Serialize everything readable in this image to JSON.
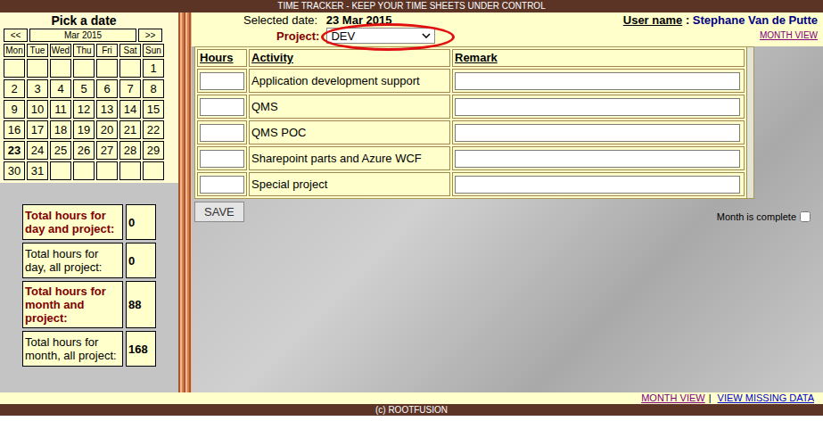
{
  "header": {
    "title": "TIME TRACKER - KEEP YOUR TIME SHEETS UNDER CONTROL"
  },
  "calendar": {
    "title": "Pick a date",
    "prev": "<<",
    "month": "Mar 2015",
    "next": ">>",
    "weekdays": [
      "Mon",
      "Tue",
      "Wed",
      "Thu",
      "Fri",
      "Sat",
      "Sun"
    ],
    "weeks": [
      [
        {
          "day": "",
          "selected": false
        },
        {
          "day": "",
          "selected": false
        },
        {
          "day": "",
          "selected": false
        },
        {
          "day": "",
          "selected": false
        },
        {
          "day": "",
          "selected": false
        },
        {
          "day": "",
          "selected": false
        },
        {
          "day": "1",
          "selected": false
        }
      ],
      [
        {
          "day": "2",
          "selected": false
        },
        {
          "day": "3",
          "selected": false
        },
        {
          "day": "4",
          "selected": false
        },
        {
          "day": "5",
          "selected": false
        },
        {
          "day": "6",
          "selected": false
        },
        {
          "day": "7",
          "selected": false
        },
        {
          "day": "8",
          "selected": false
        }
      ],
      [
        {
          "day": "9",
          "selected": false
        },
        {
          "day": "10",
          "selected": false
        },
        {
          "day": "11",
          "selected": false
        },
        {
          "day": "12",
          "selected": false
        },
        {
          "day": "13",
          "selected": false
        },
        {
          "day": "14",
          "selected": false
        },
        {
          "day": "15",
          "selected": false
        }
      ],
      [
        {
          "day": "16",
          "selected": false
        },
        {
          "day": "17",
          "selected": false
        },
        {
          "day": "18",
          "selected": false
        },
        {
          "day": "19",
          "selected": false
        },
        {
          "day": "20",
          "selected": false
        },
        {
          "day": "21",
          "selected": false
        },
        {
          "day": "22",
          "selected": false
        }
      ],
      [
        {
          "day": "23",
          "selected": true
        },
        {
          "day": "24",
          "selected": false
        },
        {
          "day": "25",
          "selected": false
        },
        {
          "day": "26",
          "selected": false
        },
        {
          "day": "27",
          "selected": false
        },
        {
          "day": "28",
          "selected": false
        },
        {
          "day": "29",
          "selected": false
        }
      ],
      [
        {
          "day": "30",
          "selected": false
        },
        {
          "day": "31",
          "selected": false
        },
        {
          "day": "",
          "selected": false
        },
        {
          "day": "",
          "selected": false
        },
        {
          "day": "",
          "selected": false
        },
        {
          "day": "",
          "selected": false
        },
        {
          "day": "",
          "selected": false
        }
      ]
    ]
  },
  "totals": [
    {
      "label": "Total hours for day and project:",
      "value": "0",
      "highlight": true
    },
    {
      "label": "Total hours for day, all project:",
      "value": "0",
      "highlight": false
    },
    {
      "label": "Total hours for month and project:",
      "value": "88",
      "highlight": true
    },
    {
      "label": "Total hours for month, all project:",
      "value": "168",
      "highlight": false
    }
  ],
  "selected_date": {
    "label": "Selected date:",
    "value": "23 Mar 2015"
  },
  "project": {
    "label": "Project:",
    "value": "DEV",
    "highlighted": true
  },
  "user": {
    "label": "User name",
    "separator": ":",
    "value": "Stephane Van de Putte"
  },
  "month_view_link": "MONTH VIEW",
  "table": {
    "columns": [
      "Hours",
      "Activity",
      "Remark"
    ],
    "rows": [
      {
        "hours": "",
        "activity": "Application development support",
        "remark": ""
      },
      {
        "hours": "",
        "activity": "QMS",
        "remark": ""
      },
      {
        "hours": "",
        "activity": "QMS POC",
        "remark": ""
      },
      {
        "hours": "",
        "activity": "Sharepoint parts and Azure WCF",
        "remark": ""
      },
      {
        "hours": "",
        "activity": "Special project",
        "remark": ""
      }
    ]
  },
  "save_button": "SAVE",
  "month_complete": {
    "label": "Month is complete",
    "checked": false
  },
  "footer_links": {
    "items": [
      "MONTH VIEW",
      "VIEW MISSING DATA"
    ],
    "separator": "|"
  },
  "copyright": "(c) ROOTFUSION"
}
